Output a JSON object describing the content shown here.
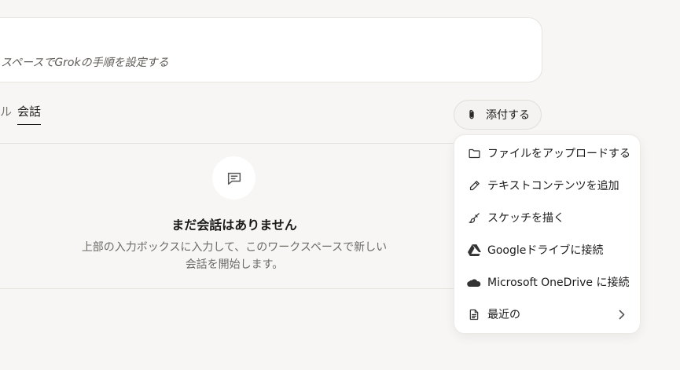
{
  "instructions": {
    "text": "スペースでGrokの手順を設定する"
  },
  "tabs": [
    {
      "label": "ル"
    },
    {
      "label": "会話"
    }
  ],
  "attach": {
    "label": "添付する"
  },
  "empty_state": {
    "title": "まだ会話はありません",
    "line1": "上部の入力ボックスに入力して、このワークスペースで新しい",
    "line2": "会話を開始します。"
  },
  "menu": {
    "items": [
      {
        "label": "ファイルをアップロードする",
        "icon": "folder-icon"
      },
      {
        "label": "テキストコンテンツを追加",
        "icon": "pencil-icon"
      },
      {
        "label": "スケッチを描く",
        "icon": "paintbrush-icon"
      },
      {
        "label": "Googleドライブに接続",
        "icon": "google-drive-icon"
      },
      {
        "label": "Microsoft OneDrive に接続",
        "icon": "onedrive-icon"
      },
      {
        "label": "最近の",
        "icon": "document-icon"
      }
    ]
  },
  "colors": {
    "background": "#f7f6f4",
    "card": "#ffffff",
    "border": "#e7e4e0",
    "text": "#1a1a1a",
    "muted": "#6e6b67"
  }
}
